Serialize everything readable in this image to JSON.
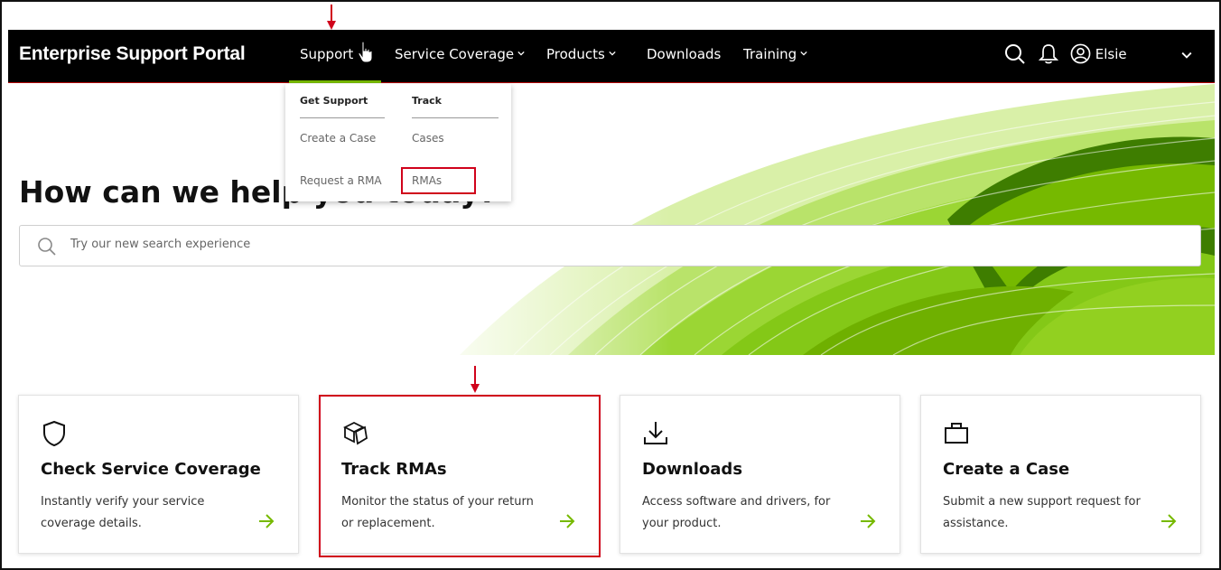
{
  "brand": {
    "title": "Enterprise Support Portal"
  },
  "nav": {
    "items": [
      {
        "label": "Support",
        "has_chevron": false,
        "active": true
      },
      {
        "label": "Service Coverage",
        "has_chevron": true
      },
      {
        "label": "Products",
        "has_chevron": true
      },
      {
        "label": "Downloads",
        "has_chevron": false
      },
      {
        "label": "Training",
        "has_chevron": true
      }
    ],
    "user_name": "Elsie",
    "icons": [
      "search-icon",
      "bell-icon",
      "user-icon",
      "chevron-down-icon"
    ]
  },
  "dropdown": {
    "columns": [
      {
        "heading": "Get Support",
        "links": [
          "Create a Case",
          "Request a RMA"
        ]
      },
      {
        "heading": "Track",
        "links": [
          "Cases",
          "RMAs"
        ]
      }
    ]
  },
  "hero": {
    "title": "How can we help you today?",
    "search_placeholder": "Try our new search experience"
  },
  "cards": [
    {
      "title": "Check Service Coverage",
      "description": "Instantly verify your service coverage details.",
      "icon": "shield-icon"
    },
    {
      "title": "Track RMAs",
      "description": "Monitor the status of your return or replacement.",
      "icon": "package-icon"
    },
    {
      "title": "Downloads",
      "description": "Access software and drivers, for your product.",
      "icon": "download-icon"
    },
    {
      "title": "Create a Case",
      "description": "Submit a new support request for assistance.",
      "icon": "briefcase-icon"
    }
  ],
  "colors": {
    "accent": "#76b900",
    "annotation": "#d0021b",
    "nav_bg": "#000000"
  }
}
